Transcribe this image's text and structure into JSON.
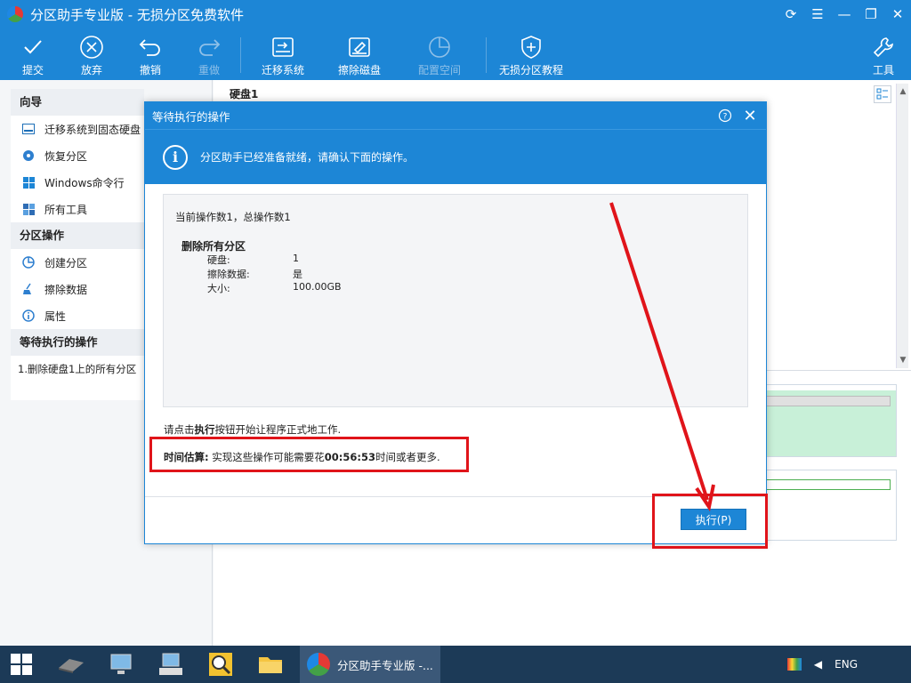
{
  "window": {
    "title": "分区助手专业版 - 无损分区免费软件"
  },
  "toolbar": {
    "commit": "提交",
    "discard": "放弃",
    "undo": "撤销",
    "redo": "重做",
    "migrate": "迁移系统",
    "wipe": "擦除磁盘",
    "allocate": "配置空间",
    "tutorial": "无损分区教程",
    "tools": "工具"
  },
  "sidebar": {
    "wizard": {
      "header": "向导",
      "items": [
        "迁移系统到固态硬盘",
        "恢复分区",
        "Windows命令行",
        "所有工具"
      ]
    },
    "partition_ops": {
      "header": "分区操作",
      "items": [
        "创建分区",
        "擦除数据",
        "属性"
      ]
    },
    "pending": {
      "header": "等待执行的操作",
      "items": [
        "1.删除硬盘1上的所有分区"
      ]
    }
  },
  "main": {
    "disk_label": "硬盘1"
  },
  "dialog": {
    "title": "等待执行的操作",
    "info": "分区助手已经准备就绪，请确认下面的操作。",
    "op_count": "当前操作数1，总操作数1",
    "operation": {
      "name": "删除所有分区",
      "rows": [
        {
          "key": "硬盘:",
          "value": "1"
        },
        {
          "key": "擦除数据:",
          "value": "是"
        },
        {
          "key": "大小:",
          "value": "100.00GB"
        }
      ]
    },
    "hint_prefix": "请点击",
    "hint_bold": "执行",
    "hint_suffix": "按钮开始让程序正式地工作.",
    "estimate_label": "时间估算:",
    "estimate_prefix": " 实现这些操作可能需要花",
    "estimate_time": "00:56:53",
    "estimate_suffix": "时间或者更多.",
    "execute_label": "执行(P)"
  },
  "taskbar": {
    "active_app": "分区助手专业版 -...",
    "lang": "ENG"
  },
  "colors": {
    "accent": "#1d86d6",
    "annotation": "#e0141a",
    "taskbar": "#1c3a57"
  }
}
